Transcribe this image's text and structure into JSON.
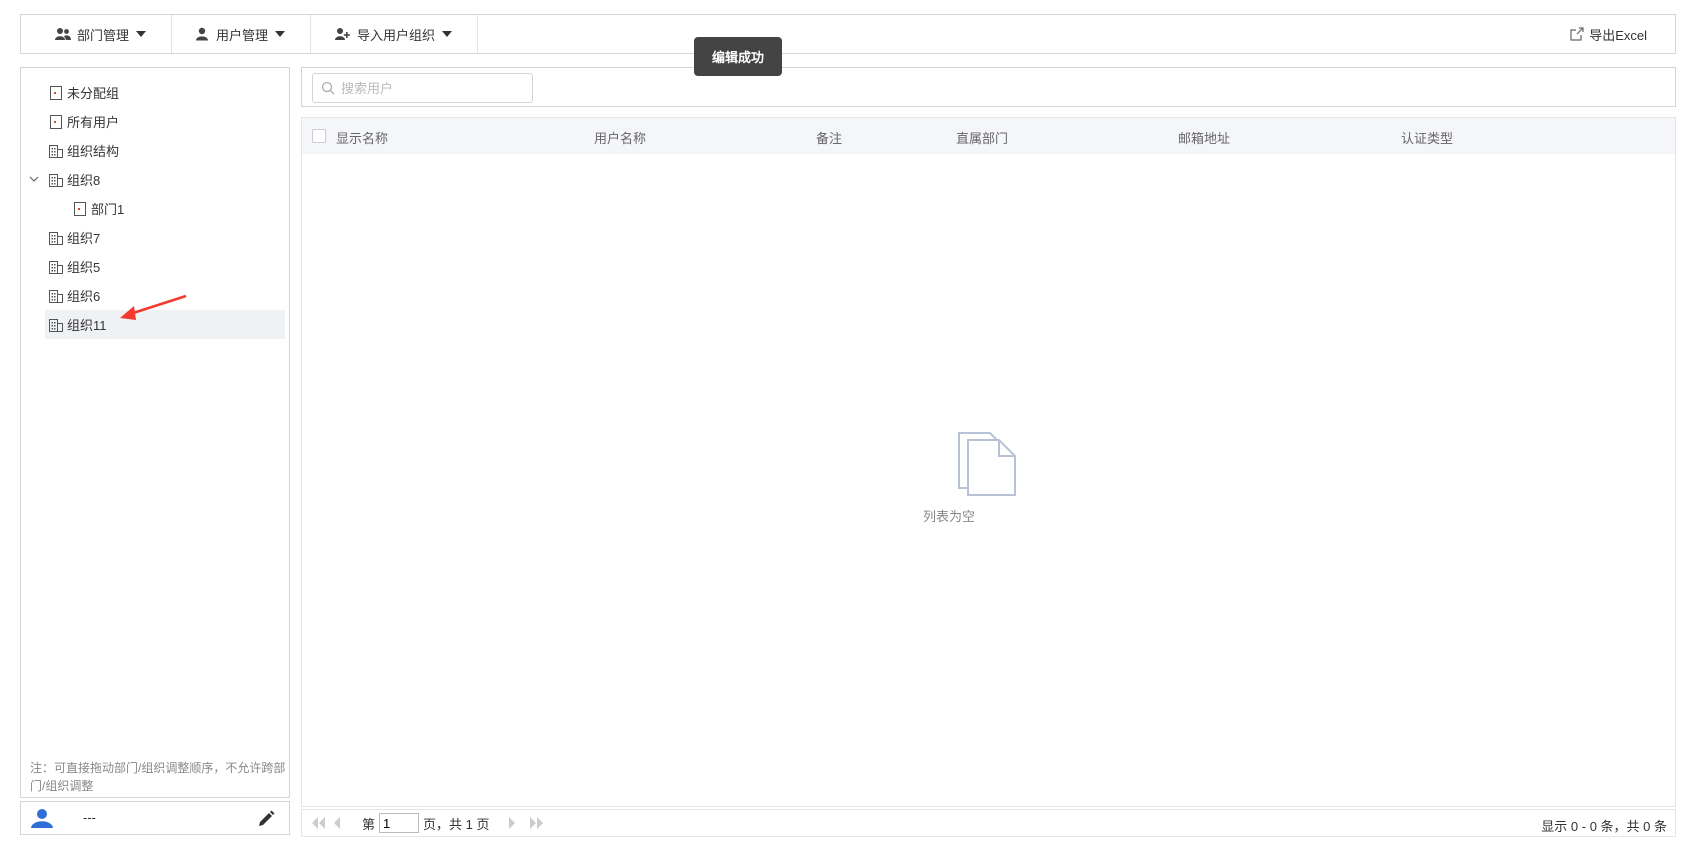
{
  "toolbar": {
    "dept_manage": "部门管理",
    "user_manage": "用户管理",
    "import_org": "导入用户组织",
    "export_excel": "导出Excel"
  },
  "toast": "编辑成功",
  "tree": {
    "items": [
      {
        "label": "未分配组",
        "icon": "dept-icon"
      },
      {
        "label": "所有用户",
        "icon": "dept-icon"
      },
      {
        "label": "组织结构",
        "icon": "building-icon"
      },
      {
        "label": "组织8",
        "icon": "building-icon",
        "expanded": true
      },
      {
        "label": "部门1",
        "icon": "dept-icon",
        "child": true
      },
      {
        "label": "组织7",
        "icon": "building-icon"
      },
      {
        "label": "组织5",
        "icon": "building-icon"
      },
      {
        "label": "组织6",
        "icon": "building-icon"
      },
      {
        "label": "组织11",
        "icon": "building-icon",
        "selected": true
      }
    ]
  },
  "sidebar": {
    "note": "注：可直接拖动部门/组织调整顺序，不允许跨部门/组织调整",
    "user_name": "---"
  },
  "search": {
    "placeholder": "搜索用户"
  },
  "grid": {
    "columns": [
      "显示名称",
      "用户名称",
      "备注",
      "直属部门",
      "邮箱地址",
      "认证类型"
    ],
    "empty_text": "列表为空"
  },
  "pager": {
    "page_prefix": "第",
    "current_page": "1",
    "page_suffix": "页，共 1 页",
    "summary": "显示 0 - 0 条，共 0 条"
  },
  "colors": {
    "accent_red": "#f23a2f",
    "user_blue": "#2f6fd6"
  }
}
